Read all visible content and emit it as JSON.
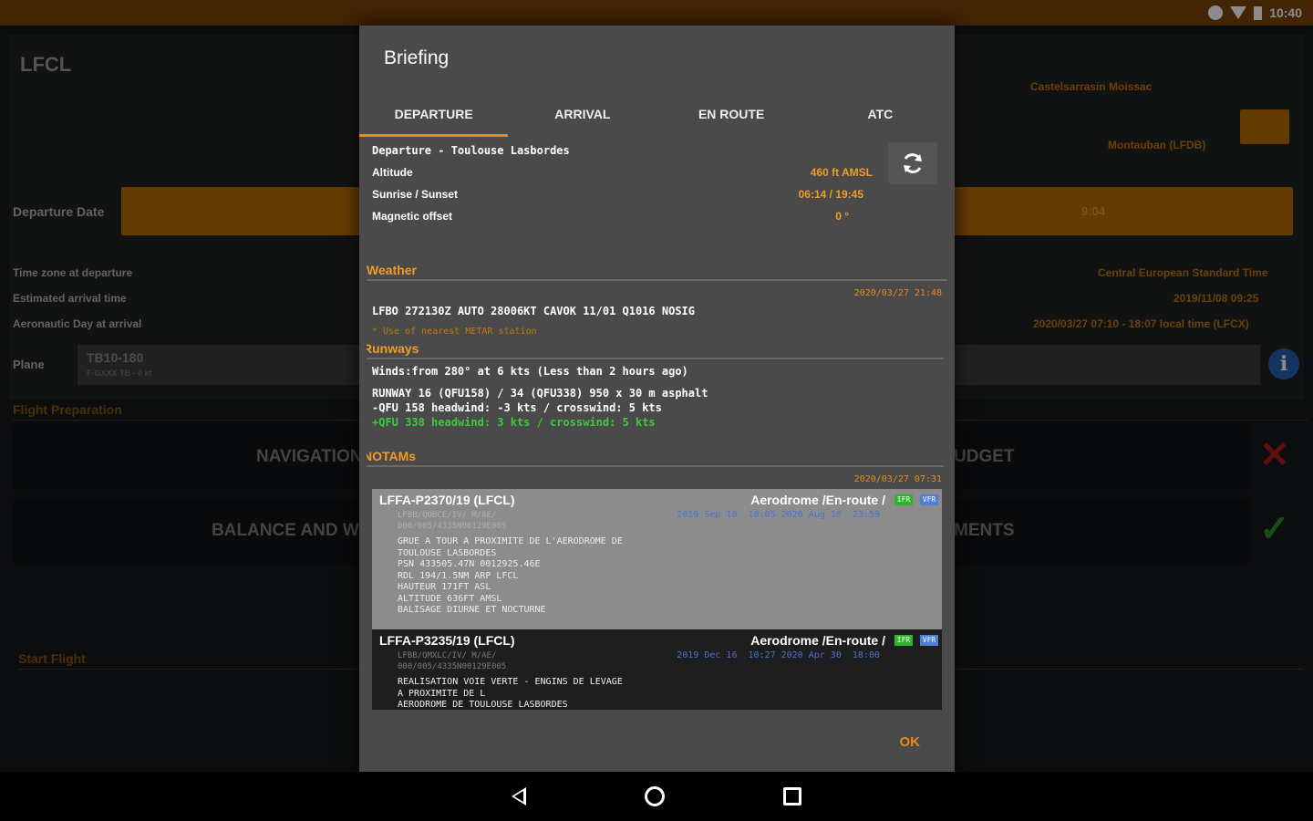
{
  "status_bar": {
    "time": "10:40"
  },
  "background": {
    "airport": "LFCL",
    "dest_name": "Castelsarrasin Moissac",
    "alt_name": "Montauban (LFDB)",
    "departure_date_label": "Departure Date",
    "departure_time": "9:04",
    "timezone_label": "Time zone at departure",
    "timezone_value": "Central European Standard Time",
    "eta_label": "Estimated arrival time",
    "eta_value": "2019/11/08 09:25",
    "aero_day_label": "Aeronautic Day at arrival",
    "aero_day_value": "2020/03/27 07:10 - 18:07 local time (LFCX)",
    "plane_label": "Plane",
    "plane_value": "TB10-180",
    "plane_sub": "F-GXXX TB - 0 kt",
    "flight_prep_label": "Flight Preparation",
    "nav_button": "NAVIGATION",
    "budget_button": "UDGET",
    "balance_button": "BALANCE AND W",
    "documents_button": "MENTS",
    "start_flight_label": "Start Flight"
  },
  "dialog": {
    "title": "Briefing",
    "tabs": [
      "DEPARTURE",
      "ARRIVAL",
      "EN ROUTE",
      "ATC"
    ],
    "active_tab": 0,
    "departure_header": "Departure - Toulouse Lasbordes",
    "altitude_label": "Altitude",
    "altitude_value": "460 ft AMSL",
    "sun_label": "Sunrise / Sunset",
    "sun_value": "06:14 / 19:45",
    "mag_label": "Magnetic offset",
    "mag_value": "0 °",
    "weather_title": "Weather",
    "weather_stamp": "2020/03/27 21:48",
    "metar": "LFBO 272130Z AUTO 28006KT CAVOK 11/01 Q1016 NOSIG",
    "metar_note": "* Use of nearest METAR station",
    "runways_title": "Runways",
    "winds": "Winds:from 280° at 6 kts (Less than 2 hours ago)",
    "runway_line": "RUNWAY 16 (QFU158) / 34 (QFU338) 950 x 30 m asphalt",
    "qfu158": "-QFU 158 headwind: -3 kts / crosswind: 5 kts",
    "qfu338": "+QFU 338 headwind: 3 kts / crosswind: 5 kts",
    "notams_title": "NOTAMs",
    "notams_stamp": "2020/03/27 07:31",
    "notams": [
      {
        "id": "LFFA-P2370/19 (LFCL)",
        "type": "Aerodrome /En-route /",
        "tag1": "IFR",
        "tag2": "VFR",
        "code1": "LFBB/QOBCE/IV/  M/AE/",
        "code2": "000/005/4335N00129E005",
        "dates": "2019 Sep 10  10:05 2020 Aug 10  23:59",
        "text": "GRUE A TOUR A PROXIMITE DE L'AERODROME DE\nTOULOUSE LASBORDES\nPSN 433505.47N 0012925.46E\nRDL 194/1.5NM ARP LFCL\nHAUTEUR 171FT ASL\nALTITUDE 636FT AMSL\nBALISAGE DIURNE ET NOCTURNE"
      },
      {
        "id": "LFFA-P3235/19 (LFCL)",
        "type": "Aerodrome /En-route /",
        "tag1": "IFR",
        "tag2": "VFR",
        "code1": "LFBB/QMXLC/IV/  M/AE/",
        "code2": "000/005/4335N00129E005",
        "dates": "2019 Dec 16  10:27 2020 Apr 30  18:00",
        "text": "REALISATION VOIE VERTE - ENGINS DE LEVAGE\nA PROXIMITE DE L\nAERODROME DE TOULOUSE LASBORDES"
      }
    ],
    "ok_label": "OK"
  }
}
